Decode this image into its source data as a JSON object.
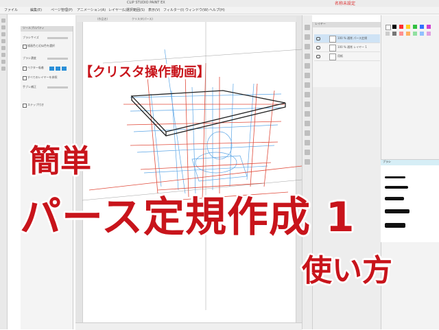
{
  "window": {
    "title": "CLIP STUDIO PAINT EX",
    "top_right_text": "名称未設定"
  },
  "menu": [
    "ファイル",
    "編集(E)",
    "ページ管理(P)",
    "アニメーション(A)",
    "レイヤー(L)",
    "選択範囲(S)",
    "表示(V)",
    "フィルター(I)",
    "ウィンドウ(W)",
    "ヘルプ(H)"
  ],
  "tabs": [
    "(作品名)",
    "クリスタ(パース)"
  ],
  "tool_property": {
    "header": "ツールプロパティ",
    "rows": [
      "ブラシサイズ",
      "描画色と近似色を選択",
      "ブラシ濃度",
      "ベクター吸着",
      "すべてのレイヤーを参照",
      "手ブレ補正",
      "ステップ付き"
    ]
  },
  "layers": {
    "header": "レイヤー",
    "rows": [
      "100 % 通常 パース定規",
      "100 % 通常 レイヤー 1",
      "用紙"
    ]
  },
  "brush_panel": {
    "header": "ブラシ"
  },
  "overlay": {
    "subtitle": "【クリスタ操作動画】",
    "easy": "簡単",
    "main": "パース定規作成 1",
    "how_to": "使い方"
  },
  "colors": {
    "overlay_red": "#c8141b",
    "perspective_red": "#e04a3a",
    "perspective_blue": "#5aa5e6"
  }
}
